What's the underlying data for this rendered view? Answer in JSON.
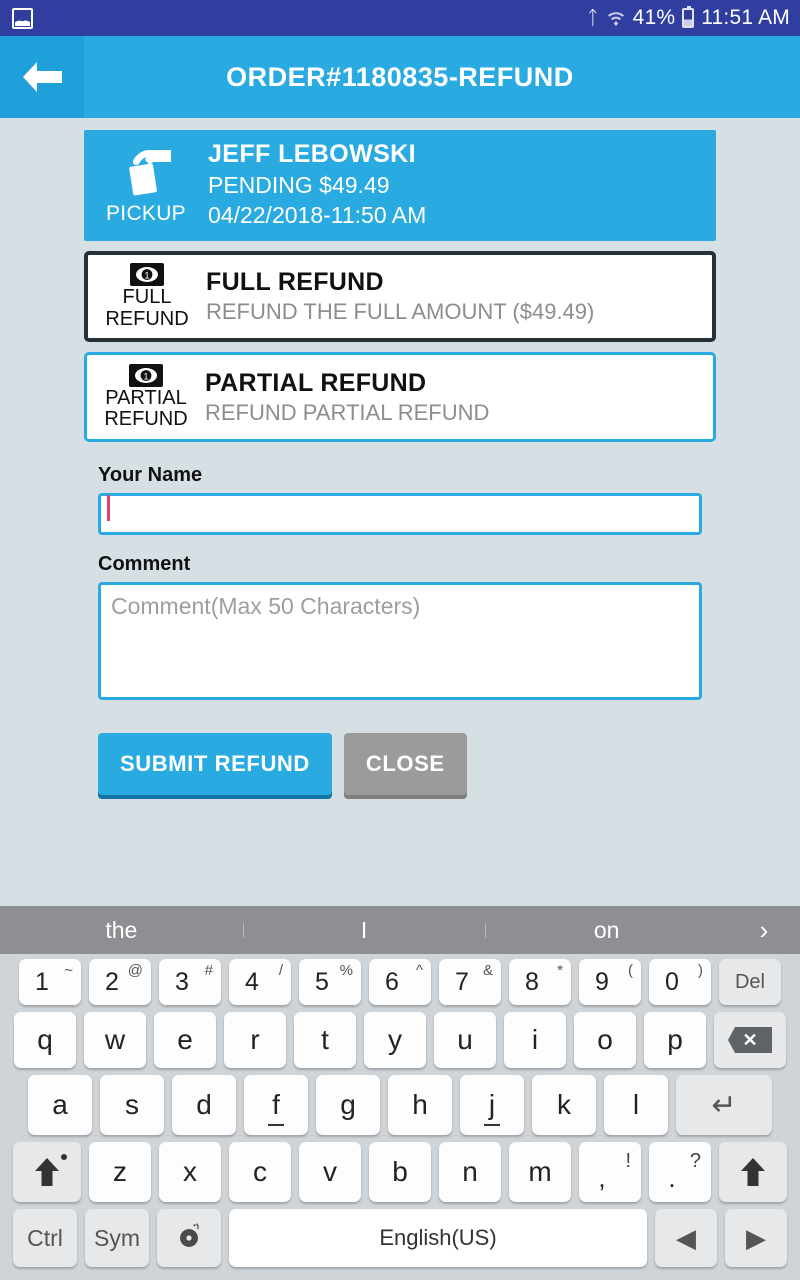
{
  "status_bar": {
    "left_icon": "gallery-icon",
    "bluetooth_icon": "bluetooth-icon",
    "wifi_icon": "wifi-icon",
    "battery_percent": "41%",
    "battery_icon": "battery-icon",
    "time": "11:51 AM"
  },
  "appbar": {
    "back_icon": "back-arrow-icon",
    "title": "ORDER#1180835-REFUND",
    "background": "#29abe2"
  },
  "order_card": {
    "type_icon": "pickup-hand-icon",
    "type_label": "PICKUP",
    "customer_name": "JEFF LEBOWSKI",
    "status_amount": "PENDING $49.49",
    "datetime": "04/22/2018-11:50 AM",
    "background": "#29abe2"
  },
  "refund_options": [
    {
      "icon": "banknote-icon",
      "icon_label_line1": "FULL",
      "icon_label_line2": "REFUND",
      "title": "FULL REFUND",
      "subtitle": "REFUND THE FULL AMOUNT ($49.49)",
      "selected": true,
      "border_color": "#263238"
    },
    {
      "icon": "banknote-icon",
      "icon_label_line1": "PARTIAL",
      "icon_label_line2": "REFUND",
      "title": "PARTIAL REFUND",
      "subtitle": "REFUND PARTIAL REFUND",
      "selected": false,
      "border_color": "#29abe2"
    }
  ],
  "form": {
    "name_label": "Your Name",
    "name_value": "",
    "name_placeholder": "",
    "comment_label": "Comment",
    "comment_value": "",
    "comment_placeholder": "Comment(Max 50 Characters)"
  },
  "buttons": {
    "submit_label": "SUBMIT REFUND",
    "submit_color": "#29abe2",
    "close_label": "CLOSE",
    "close_color": "#9b9b9b"
  },
  "keyboard": {
    "suggestions": [
      "the",
      "I",
      "on"
    ],
    "expand_icon": "chevron-right-icon",
    "number_row": [
      {
        "base": "1",
        "sup": "~"
      },
      {
        "base": "2",
        "sup": "@"
      },
      {
        "base": "3",
        "sup": "#"
      },
      {
        "base": "4",
        "sup": "/"
      },
      {
        "base": "5",
        "sup": "%"
      },
      {
        "base": "6",
        "sup": "^"
      },
      {
        "base": "7",
        "sup": "&"
      },
      {
        "base": "8",
        "sup": "*"
      },
      {
        "base": "9",
        "sup": "("
      },
      {
        "base": "0",
        "sup": ")"
      }
    ],
    "del_label": "Del",
    "row_q": [
      "q",
      "w",
      "e",
      "r",
      "t",
      "y",
      "u",
      "i",
      "o",
      "p"
    ],
    "backspace_icon": "backspace-icon",
    "row_a": [
      "a",
      "s",
      "d",
      "f",
      "g",
      "h",
      "j",
      "k",
      "l"
    ],
    "enter_icon": "enter-icon",
    "row_z": [
      "z",
      "x",
      "c",
      "v",
      "b",
      "n",
      "m"
    ],
    "comma_key": {
      "base": ",",
      "sup": "!"
    },
    "period_key": {
      "base": ".",
      "sup": "?"
    },
    "shift_icon": "shift-arrow-icon",
    "ctrl_label": "Ctrl",
    "sym_label": "Sym",
    "settings_icon": "gear-icon",
    "space_label": "English(US)",
    "arrow_left_icon": "arrow-left-icon",
    "arrow_right_icon": "arrow-right-icon"
  }
}
